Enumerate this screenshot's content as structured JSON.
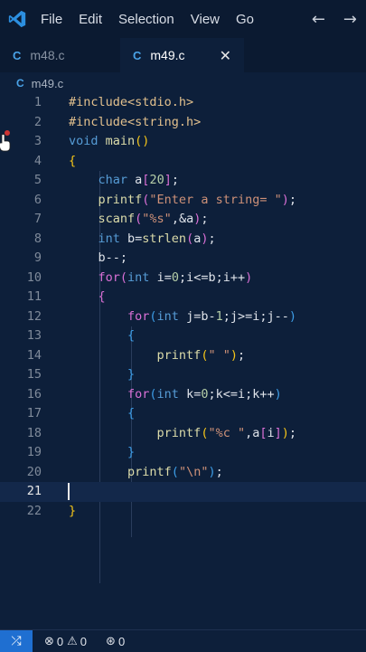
{
  "menubar": {
    "items": [
      "File",
      "Edit",
      "Selection",
      "View",
      "Go"
    ],
    "back_icon": "arrow-left-icon",
    "forward_icon": "arrow-right-icon"
  },
  "tabs": [
    {
      "icon": "C",
      "label": "m48.c",
      "active": false
    },
    {
      "icon": "C",
      "label": "m49.c",
      "active": true,
      "close": "✕"
    }
  ],
  "breadcrumb": {
    "icon": "C",
    "label": "m49.c"
  },
  "editor": {
    "current_line": 21,
    "lines": [
      {
        "n": "1",
        "tokens": [
          [
            "#include<stdio.h>",
            "t-inc"
          ]
        ]
      },
      {
        "n": "2",
        "tokens": [
          [
            "#include<string.h>",
            "t-inc"
          ]
        ]
      },
      {
        "n": "3",
        "tokens": [
          [
            "void ",
            "t-kw"
          ],
          [
            "main",
            "t-fn"
          ],
          [
            "()",
            "t-br1"
          ]
        ]
      },
      {
        "n": "4",
        "tokens": [
          [
            "{",
            "t-br1"
          ]
        ]
      },
      {
        "n": "5",
        "tokens": [
          [
            "    char ",
            "t-kw"
          ],
          [
            "a",
            "t-plain"
          ],
          [
            "[",
            "t-br2"
          ],
          [
            "20",
            "t-num"
          ],
          [
            "]",
            "t-br2"
          ],
          [
            ";",
            "t-plain"
          ]
        ]
      },
      {
        "n": "6",
        "tokens": [
          [
            "    printf",
            "t-fn"
          ],
          [
            "(",
            "t-br2"
          ],
          [
            "\"Enter a string= \"",
            "t-str"
          ],
          [
            ")",
            "t-br2"
          ],
          [
            ";",
            "t-plain"
          ]
        ]
      },
      {
        "n": "7",
        "tokens": [
          [
            "    scanf",
            "t-fn"
          ],
          [
            "(",
            "t-br2"
          ],
          [
            "\"%s\"",
            "t-str"
          ],
          [
            ",&a",
            "t-plain"
          ],
          [
            ")",
            "t-br2"
          ],
          [
            ";",
            "t-plain"
          ]
        ]
      },
      {
        "n": "8",
        "tokens": [
          [
            "    int ",
            "t-kw"
          ],
          [
            "b=",
            "t-plain"
          ],
          [
            "strlen",
            "t-fn"
          ],
          [
            "(",
            "t-br2"
          ],
          [
            "a",
            "t-plain"
          ],
          [
            ")",
            "t-br2"
          ],
          [
            ";",
            "t-plain"
          ]
        ]
      },
      {
        "n": "9",
        "tokens": [
          [
            "    b--;",
            "t-plain"
          ]
        ]
      },
      {
        "n": "10",
        "tokens": [
          [
            "    for",
            "t-br2"
          ],
          [
            "(",
            "t-br2"
          ],
          [
            "int ",
            "t-kw"
          ],
          [
            "i=",
            "t-plain"
          ],
          [
            "0",
            "t-num"
          ],
          [
            ";i<=b;i++",
            "t-plain"
          ],
          [
            ")",
            "t-br2"
          ]
        ]
      },
      {
        "n": "11",
        "tokens": [
          [
            "    {",
            "t-br2"
          ]
        ]
      },
      {
        "n": "12",
        "tokens": [
          [
            "        for",
            "t-br2"
          ],
          [
            "(",
            "t-br3"
          ],
          [
            "int ",
            "t-kw"
          ],
          [
            "j=b-",
            "t-plain"
          ],
          [
            "1",
            "t-num"
          ],
          [
            ";j>=i;j--",
            "t-plain"
          ],
          [
            ")",
            "t-br3"
          ]
        ]
      },
      {
        "n": "13",
        "tokens": [
          [
            "        {",
            "t-br3"
          ]
        ]
      },
      {
        "n": "14",
        "tokens": [
          [
            "            printf",
            "t-fn"
          ],
          [
            "(",
            "t-br1"
          ],
          [
            "\" \"",
            "t-str"
          ],
          [
            ")",
            "t-br1"
          ],
          [
            ";",
            "t-plain"
          ]
        ]
      },
      {
        "n": "15",
        "tokens": [
          [
            "        }",
            "t-br3"
          ]
        ]
      },
      {
        "n": "16",
        "tokens": [
          [
            "        for",
            "t-br2"
          ],
          [
            "(",
            "t-br3"
          ],
          [
            "int ",
            "t-kw"
          ],
          [
            "k=",
            "t-plain"
          ],
          [
            "0",
            "t-num"
          ],
          [
            ";k<=i;k++",
            "t-plain"
          ],
          [
            ")",
            "t-br3"
          ]
        ]
      },
      {
        "n": "17",
        "tokens": [
          [
            "        {",
            "t-br3"
          ]
        ]
      },
      {
        "n": "18",
        "tokens": [
          [
            "            printf",
            "t-fn"
          ],
          [
            "(",
            "t-br1"
          ],
          [
            "\"%c \"",
            "t-str"
          ],
          [
            ",a",
            "t-plain"
          ],
          [
            "[",
            "t-br2"
          ],
          [
            "i",
            "t-plain"
          ],
          [
            "]",
            "t-br2"
          ],
          [
            ")",
            "t-br1"
          ],
          [
            ";",
            "t-plain"
          ]
        ]
      },
      {
        "n": "19",
        "tokens": [
          [
            "        }",
            "t-br3"
          ]
        ]
      },
      {
        "n": "20",
        "tokens": [
          [
            "        printf",
            "t-fn"
          ],
          [
            "(",
            "t-br3"
          ],
          [
            "\"\\n\"",
            "t-str"
          ],
          [
            ")",
            "t-br3"
          ],
          [
            ";",
            "t-plain"
          ]
        ]
      },
      {
        "n": "21",
        "tokens": []
      },
      {
        "n": "22",
        "tokens": [
          [
            "}",
            "t-br1"
          ]
        ]
      }
    ]
  },
  "statusbar": {
    "remote_icon": "remote-icon",
    "errors": "0",
    "warnings": "0",
    "ports": "0"
  },
  "colors": {
    "background": "#0d1f3a",
    "accent": "#1f6fd1"
  }
}
